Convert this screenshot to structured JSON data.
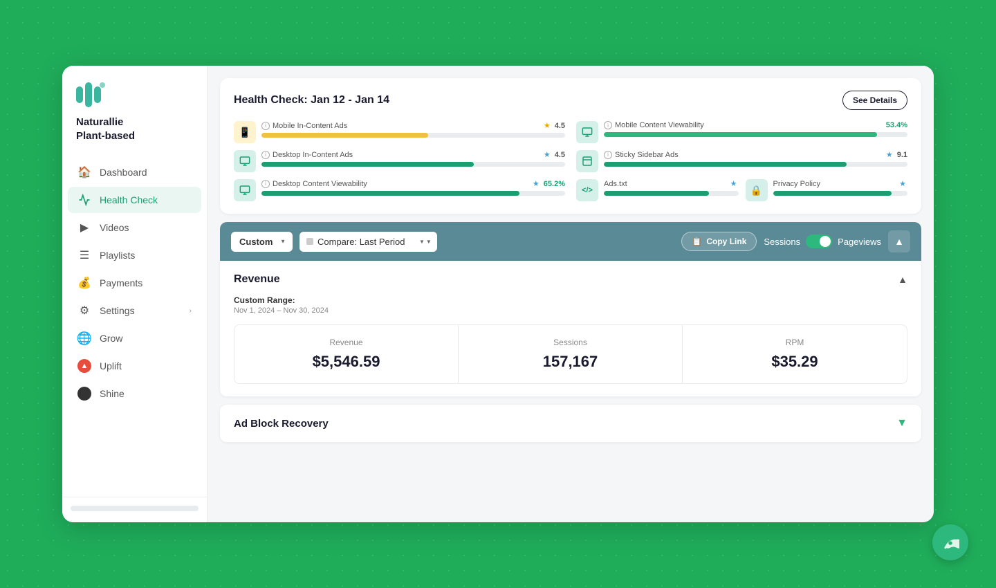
{
  "app": {
    "brand_line1": "Naturallie",
    "brand_line2": "Plant-based"
  },
  "sidebar": {
    "items": [
      {
        "id": "dashboard",
        "label": "Dashboard",
        "icon": "🏠",
        "active": false
      },
      {
        "id": "health-check",
        "label": "Health Check",
        "icon": "💓",
        "active": true
      },
      {
        "id": "videos",
        "label": "Videos",
        "icon": "▶",
        "active": false
      },
      {
        "id": "playlists",
        "label": "Playlists",
        "icon": "☰",
        "active": false
      },
      {
        "id": "payments",
        "label": "Payments",
        "icon": "💰",
        "active": false
      },
      {
        "id": "settings",
        "label": "Settings",
        "icon": "⚙",
        "active": false,
        "arrow": "›"
      },
      {
        "id": "grow",
        "label": "Grow",
        "icon": "🌐",
        "active": false
      },
      {
        "id": "uplift",
        "label": "Uplift",
        "icon": "🔴",
        "active": false
      },
      {
        "id": "shine",
        "label": "Shine",
        "icon": "⚫",
        "active": false
      }
    ]
  },
  "health_check": {
    "title": "Health Check: Jan 12 - Jan 14",
    "see_details_label": "See Details",
    "metrics": [
      {
        "id": "mobile-in-content",
        "label": "Mobile In-Content Ads",
        "score": "4.5",
        "score_type": "star",
        "fill_pct": 55,
        "fill_class": "fill-yellow",
        "icon": "📱",
        "icon_class": "yellow"
      },
      {
        "id": "mobile-content-viewability",
        "label": "Mobile Content Viewability",
        "score": "53.4%",
        "score_type": "number",
        "fill_pct": 90,
        "fill_class": "fill-green",
        "icon": "📊",
        "icon_class": "teal"
      },
      {
        "id": "desktop-in-content",
        "label": "Desktop In-Content Ads",
        "score": "4.5",
        "score_type": "star",
        "fill_pct": 70,
        "fill_class": "fill-teal",
        "icon": "🖥",
        "icon_class": "teal"
      },
      {
        "id": "sticky-sidebar",
        "label": "Sticky Sidebar Ads",
        "score": "9.1",
        "score_type": "star",
        "fill_pct": 80,
        "fill_class": "fill-teal",
        "icon": "📋",
        "icon_class": "teal"
      },
      {
        "id": "desktop-content-viewability",
        "label": "Desktop Content Viewability",
        "score": "65.2%",
        "score_type": "number_star",
        "fill_pct": 85,
        "fill_class": "fill-teal",
        "icon": "🖥",
        "icon_class": "teal"
      },
      {
        "id": "ads-txt",
        "label": "Ads.txt",
        "score": "★",
        "score_type": "star_only",
        "fill_pct": 78,
        "fill_class": "fill-teal",
        "icon": "</>",
        "icon_class": "teal"
      },
      {
        "id": "privacy-policy",
        "label": "Privacy Policy",
        "score": "★",
        "score_type": "star_only",
        "fill_pct": 88,
        "fill_class": "fill-teal",
        "icon": "🔒",
        "icon_class": "teal"
      }
    ]
  },
  "filter_bar": {
    "custom_label": "Custom",
    "compare_label": "Compare: Last Period",
    "copy_link_label": "Copy Link",
    "sessions_label": "Sessions",
    "pageviews_label": "Pageviews"
  },
  "revenue": {
    "section_title": "Revenue",
    "custom_range_label": "Custom Range:",
    "date_range": "Nov 1, 2024 – Nov 30, 2024",
    "stats": [
      {
        "label": "Revenue",
        "value": "$5,546.59"
      },
      {
        "label": "Sessions",
        "value": "157,167"
      },
      {
        "label": "RPM",
        "value": "$35.29"
      }
    ]
  },
  "ad_block": {
    "title": "Ad Block Recovery"
  }
}
